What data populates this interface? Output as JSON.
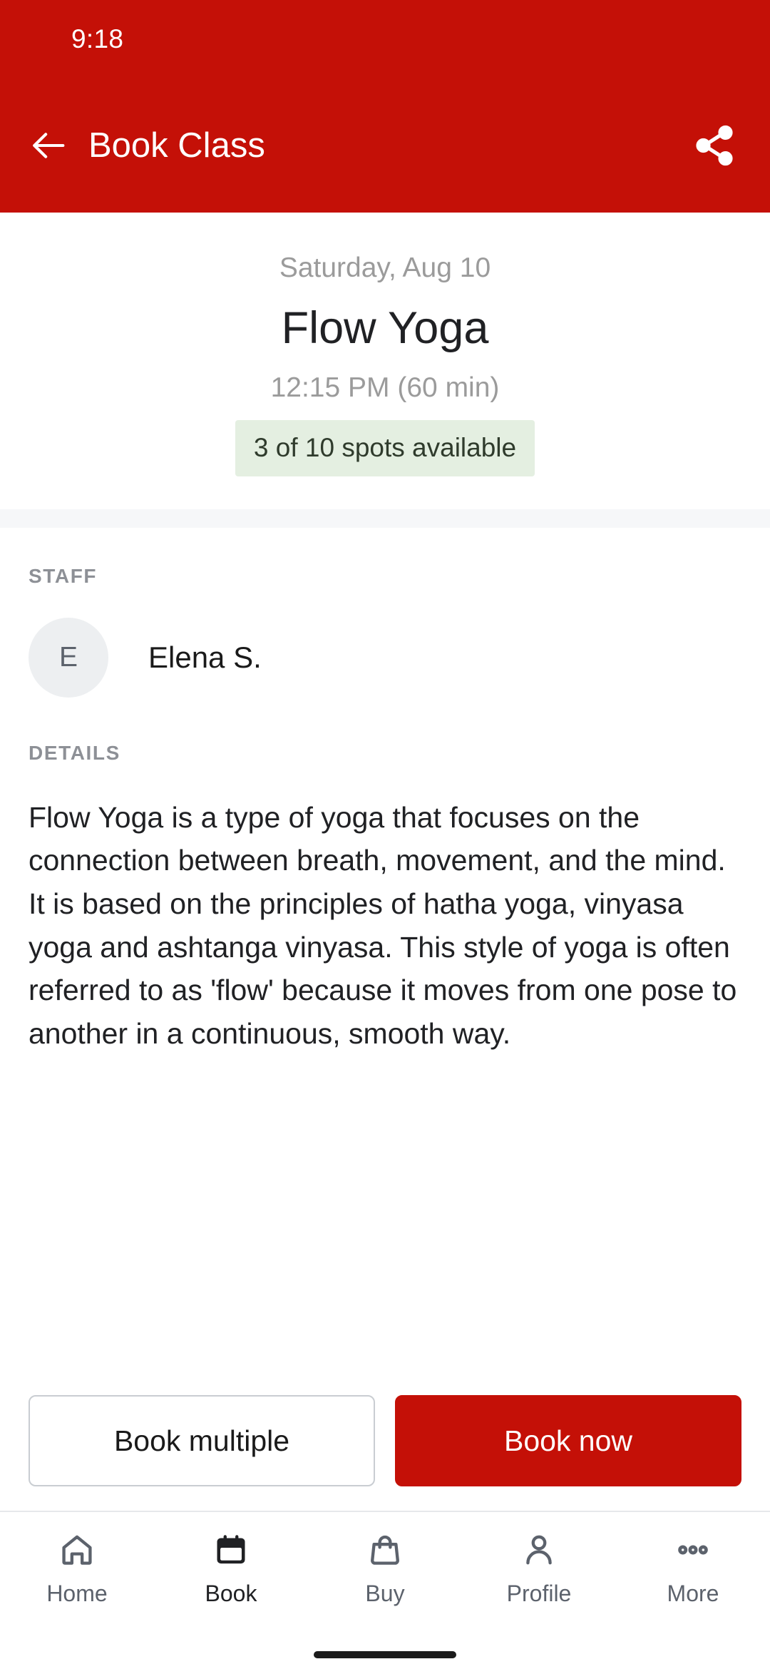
{
  "status_bar": {
    "time": "9:18"
  },
  "app_bar": {
    "title": "Book Class",
    "back_icon": "arrow-left-icon",
    "share_icon": "share-icon",
    "background_color": "#C41007"
  },
  "class": {
    "date": "Saturday, Aug 10",
    "name": "Flow Yoga",
    "time": "12:15 PM (60 min)",
    "availability": "3 of 10 spots available",
    "availability_bg_color": "#E4EFE1",
    "availability_text_color": "#2F3B2C"
  },
  "staff": {
    "section_label": "STAFF",
    "members": [
      {
        "initial": "E",
        "name": "Elena S."
      }
    ]
  },
  "details": {
    "section_label": "DETAILS",
    "description": "Flow Yoga is a type of yoga that focuses on the connection between breath, movement, and the mind. It is based on the principles of hatha yoga, vinyasa yoga and ashtanga vinyasa. This style of yoga is often referred to as 'flow' because it moves from one pose to another in a continuous, smooth way."
  },
  "actions": {
    "secondary_label": "Book multiple",
    "primary_label": "Book now",
    "primary_color": "#C41007"
  },
  "bottom_nav": {
    "items": [
      {
        "label": "Home",
        "icon": "home-icon",
        "active": false
      },
      {
        "label": "Book",
        "icon": "calendar-icon",
        "active": true
      },
      {
        "label": "Buy",
        "icon": "bag-icon",
        "active": false
      },
      {
        "label": "Profile",
        "icon": "person-icon",
        "active": false
      },
      {
        "label": "More",
        "icon": "ellipsis-icon",
        "active": false
      }
    ]
  }
}
